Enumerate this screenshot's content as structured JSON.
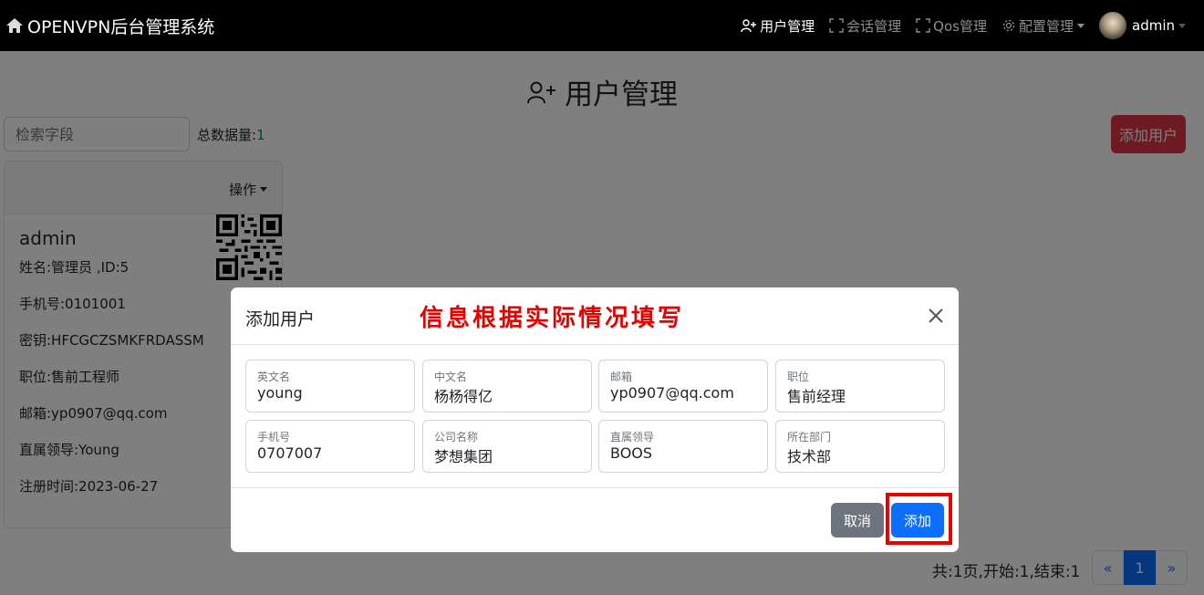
{
  "navbar": {
    "brand": "OPENVPN后台管理系统",
    "items": [
      {
        "label": "用户管理",
        "icon": "person-plus-icon"
      },
      {
        "label": "会话管理",
        "icon": "fullscreen-icon"
      },
      {
        "label": "Qos管理",
        "icon": "fullscreen-icon"
      },
      {
        "label": "配置管理",
        "icon": "gear-icon"
      }
    ],
    "user": "admin"
  },
  "page": {
    "title": "用户管理",
    "search_placeholder": "检索字段",
    "total_label": "总数据量:",
    "total_count": "1",
    "add_button": "添加用户"
  },
  "card": {
    "ops_label": "操作",
    "name": "admin",
    "lines": [
      "姓名:管理员 ,ID:5",
      "手机号:0101001",
      "密钥:HFCGCZSMKFRDASSM",
      "职位:售前工程师",
      "邮箱:yp0907@qq.com",
      "直属领导:Young",
      "注册时间:2023-06-27"
    ]
  },
  "pagination": {
    "info": "共:1页,开始:1,结束:1",
    "prev": "«",
    "current": "1",
    "next": "»"
  },
  "modal": {
    "title": "添加用户",
    "annotation": "信息根据实际情况填写",
    "fields": [
      {
        "label": "英文名",
        "value": "young"
      },
      {
        "label": "中文名",
        "value": "杨杨得亿"
      },
      {
        "label": "邮箱",
        "value": "yp0907@qq.com"
      },
      {
        "label": "职位",
        "value": "售前经理"
      },
      {
        "label": "手机号",
        "value": "0707007"
      },
      {
        "label": "公司名称",
        "value": "梦想集团"
      },
      {
        "label": "直属领导",
        "value": "BOOS"
      },
      {
        "label": "所在部门",
        "value": "技术部"
      }
    ],
    "cancel": "取消",
    "submit": "添加"
  },
  "colors": {
    "navbar": "#000000",
    "danger": "#dc3545",
    "primary": "#0d6efd",
    "secondary": "#6c757d",
    "annotation": "#e60000"
  }
}
